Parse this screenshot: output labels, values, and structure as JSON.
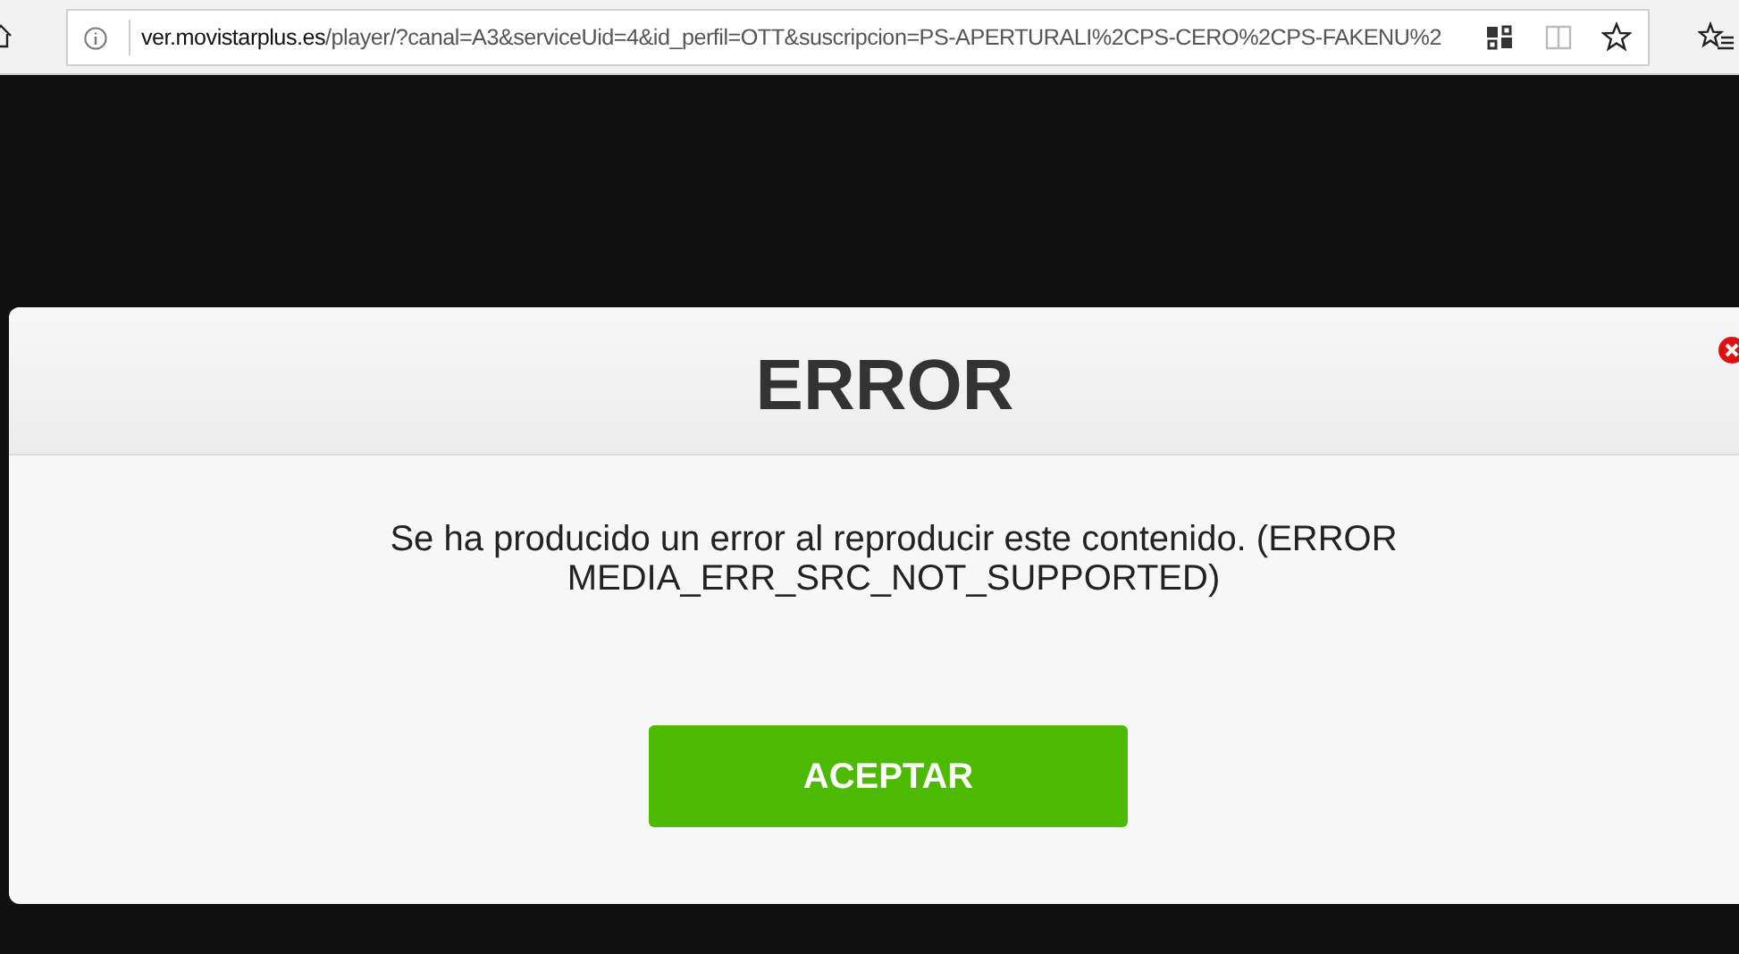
{
  "browser": {
    "url_host": "ver.movistarplus.es",
    "url_path": "/player/?canal=A3&serviceUid=4&id_perfil=OTT&suscripcion=PS-APERTURALI%2CPS-CERO%2CPS-FAKENU%2",
    "reader_disabled": true
  },
  "dialog": {
    "title": "ERROR",
    "message": "Se ha producido un error al reproducir este contenido. (ERROR MEDIA_ERR_SRC_NOT_SUPPORTED)",
    "button": "ACEPTAR"
  }
}
